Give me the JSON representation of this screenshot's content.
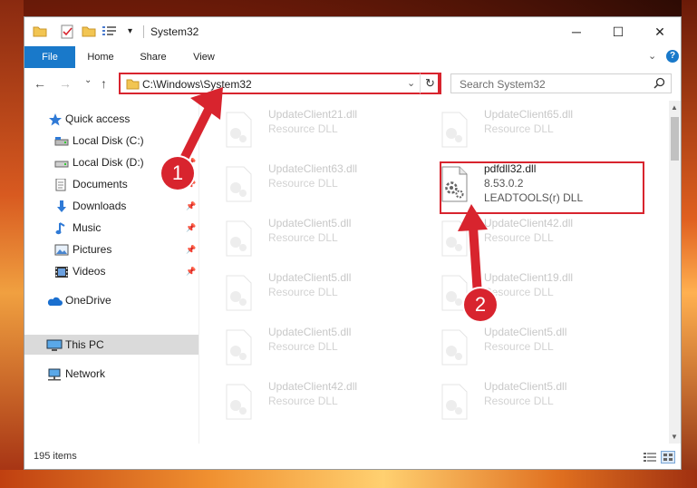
{
  "window": {
    "title": "System32",
    "controls": {
      "minimize": "─",
      "maximize": "☐",
      "close": "✕"
    }
  },
  "ribbon": {
    "tabs": [
      "File",
      "Home",
      "Share",
      "View"
    ],
    "expand": "⌄",
    "help": "?"
  },
  "nav": {
    "back": "←",
    "forward": "→",
    "recent": "⌄",
    "up": "↑",
    "address": "C:\\Windows\\System32",
    "address_drop": "⌄",
    "refresh": "↻",
    "search_placeholder": "Search System32",
    "search_icon": "search-icon"
  },
  "sidebar": {
    "items": [
      {
        "label": "Quick access",
        "icon": "star-icon",
        "pinned": false
      },
      {
        "label": "Local Disk (C:)",
        "icon": "drive-icon",
        "pinned": false
      },
      {
        "label": "Local Disk (D:)",
        "icon": "drive-icon",
        "pinned": true
      },
      {
        "label": "Documents",
        "icon": "documents-icon",
        "pinned": true
      },
      {
        "label": "Downloads",
        "icon": "download-icon",
        "pinned": true
      },
      {
        "label": "Music",
        "icon": "music-icon",
        "pinned": true
      },
      {
        "label": "Pictures",
        "icon": "pictures-icon",
        "pinned": true
      },
      {
        "label": "Videos",
        "icon": "videos-icon",
        "pinned": true
      },
      {
        "label": "OneDrive",
        "icon": "cloud-icon",
        "pinned": false
      },
      {
        "label": "This PC",
        "icon": "computer-icon",
        "pinned": false,
        "selected": true
      },
      {
        "label": "Network",
        "icon": "network-icon",
        "pinned": false
      }
    ]
  },
  "files": {
    "left": [
      {
        "name": "UpdateClient21.dll",
        "type": "Resource DLL"
      },
      {
        "name": "UpdateClient63.dll",
        "type": "Resource DLL"
      },
      {
        "name": "UpdateClient5.dll",
        "type": "Resource DLL"
      },
      {
        "name": "UpdateClient5.dll",
        "type": "Resource DLL"
      },
      {
        "name": "UpdateClient5.dll",
        "type": "Resource DLL"
      },
      {
        "name": "UpdateClient42.dll",
        "type": "Resource DLL"
      }
    ],
    "right": [
      {
        "name": "UpdateClient65.dll",
        "type": "Resource DLL"
      },
      {
        "name": "pdfdll32.dll",
        "version": "8.53.0.2",
        "type": "LEADTOOLS(r) DLL",
        "highlighted": true
      },
      {
        "name": "UpdateClient42.dll",
        "type": "Resource DLL"
      },
      {
        "name": "UpdateClient19.dll",
        "type": "Resource DLL"
      },
      {
        "name": "UpdateClient5.dll",
        "type": "Resource DLL"
      },
      {
        "name": "UpdateClient5.dll",
        "type": "Resource DLL"
      }
    ]
  },
  "status": {
    "count": "195 items"
  },
  "annotations": {
    "badge1": "1",
    "badge2": "2"
  },
  "colors": {
    "accent": "#1979ca",
    "highlight": "#d8242e",
    "selected_bg": "#dadada"
  }
}
